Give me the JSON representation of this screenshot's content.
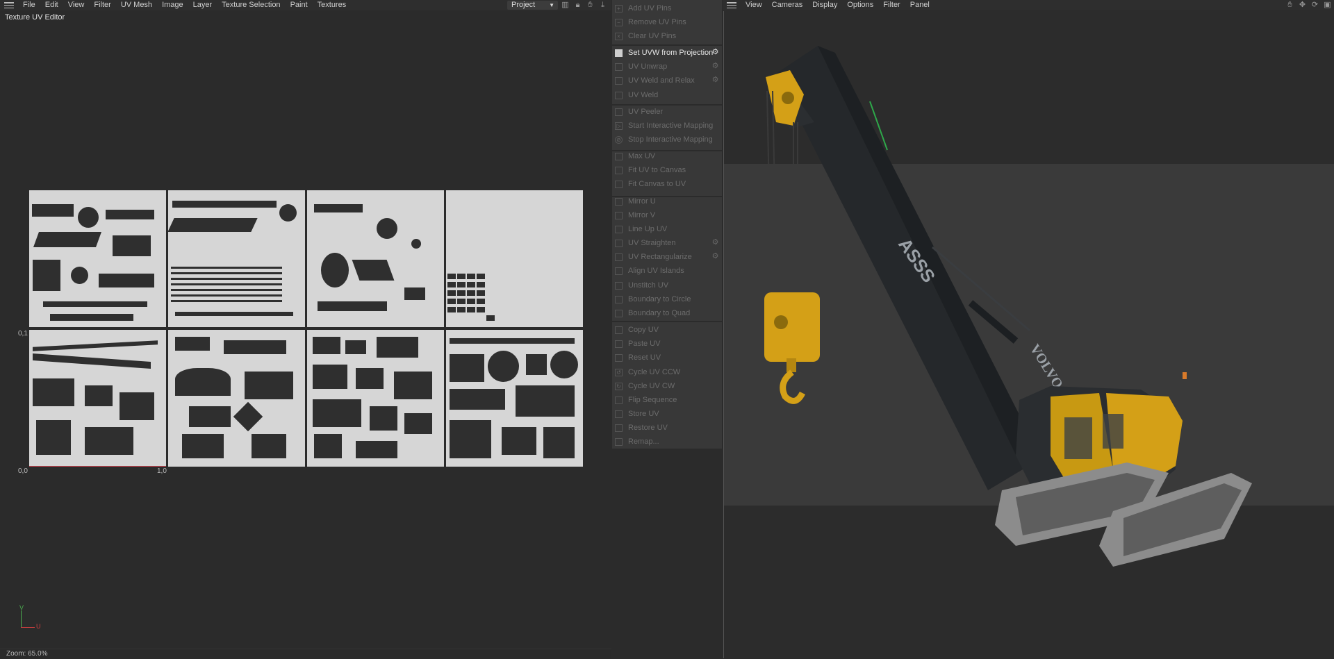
{
  "uv_editor": {
    "menu": [
      "File",
      "Edit",
      "View",
      "Filter",
      "UV Mesh",
      "Image",
      "Layer",
      "Texture Selection",
      "Paint",
      "Textures"
    ],
    "project_select": "Project",
    "title": "Texture UV Editor",
    "axis_labels": {
      "origin": "0,0",
      "u_one": "1,0",
      "v_one": "0,1"
    },
    "gizmo": {
      "v": "V",
      "u": "U"
    },
    "zoom": "Zoom: 65.0%",
    "colors": {
      "uv_tile": "#d6d6d6",
      "uv_island": "#2f2f2f",
      "u_axis": "#d04040",
      "v_axis": "#4caf50"
    }
  },
  "commands": [
    {
      "label": "Add UV Pins",
      "active": false,
      "gear": false
    },
    {
      "label": "Remove UV Pins",
      "active": false,
      "gear": false
    },
    {
      "label": "Clear UV Pins",
      "active": false,
      "gear": false
    },
    {
      "label": "Set UVW from Projection",
      "active": true,
      "gear": true
    },
    {
      "label": "UV Unwrap",
      "active": false,
      "gear": true
    },
    {
      "label": "UV Weld and Relax",
      "active": false,
      "gear": true
    },
    {
      "label": "UV Weld",
      "active": false,
      "gear": false
    },
    {
      "label": "UV Peeler",
      "active": false,
      "gear": false
    },
    {
      "label": "Start Interactive Mapping",
      "active": false,
      "gear": false
    },
    {
      "label": "Stop Interactive Mapping",
      "active": false,
      "gear": false
    },
    {
      "label": "Max UV",
      "active": false,
      "gear": false
    },
    {
      "label": "Fit UV to Canvas",
      "active": false,
      "gear": false
    },
    {
      "label": "Fit Canvas to UV",
      "active": false,
      "gear": false
    },
    {
      "label": "Mirror U",
      "active": false,
      "gear": false
    },
    {
      "label": "Mirror V",
      "active": false,
      "gear": false
    },
    {
      "label": "Line Up UV",
      "active": false,
      "gear": false
    },
    {
      "label": "UV Straighten",
      "active": false,
      "gear": true
    },
    {
      "label": "UV Rectangularize",
      "active": false,
      "gear": true
    },
    {
      "label": "Align UV Islands",
      "active": false,
      "gear": false
    },
    {
      "label": "Unstitch UV",
      "active": false,
      "gear": false
    },
    {
      "label": "Boundary to Circle",
      "active": false,
      "gear": false
    },
    {
      "label": "Boundary to Quad",
      "active": false,
      "gear": false
    },
    {
      "label": "Copy UV",
      "active": false,
      "gear": false
    },
    {
      "label": "Paste UV",
      "active": false,
      "gear": false
    },
    {
      "label": "Reset UV",
      "active": false,
      "gear": false
    },
    {
      "label": "Cycle UV CCW",
      "active": false,
      "gear": false
    },
    {
      "label": "Cycle UV CW",
      "active": false,
      "gear": false
    },
    {
      "label": "Flip Sequence",
      "active": false,
      "gear": false
    },
    {
      "label": "Store UV",
      "active": false,
      "gear": false
    },
    {
      "label": "Restore UV",
      "active": false,
      "gear": false
    },
    {
      "label": "Remap...",
      "active": false,
      "gear": false
    }
  ],
  "viewport": {
    "menu": [
      "View",
      "Cameras",
      "Display",
      "Options",
      "Filter",
      "Panel"
    ],
    "model_text": {
      "boom_number": "ASSS",
      "brand": "VOLVO"
    },
    "colors": {
      "crane_yellow": "#d4a017",
      "boom_dark": "#2a2d30",
      "track_grey": "#8c8c8c"
    }
  }
}
